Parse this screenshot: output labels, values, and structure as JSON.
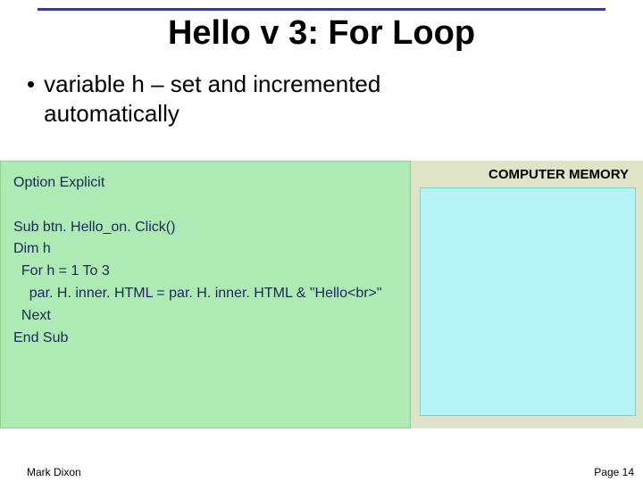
{
  "title": "Hello v 3: For Loop",
  "bullet": {
    "prefix": "variable ",
    "var": "h",
    "rest_line1": " – set and incremented",
    "line2": "automatically"
  },
  "memory_label": "COMPUTER MEMORY",
  "code": {
    "l1": "Option Explicit",
    "l2": "",
    "l3": "Sub btn. Hello_on. Click()",
    "l4": "Dim h",
    "l5": "  For h = 1 To 3",
    "l6": "    par. H. inner. HTML = par. H. inner. HTML & \"Hello<br>\"",
    "l7": "  Next",
    "l8": "End Sub"
  },
  "footer": {
    "author": "Mark Dixon",
    "page": "Page 14"
  }
}
